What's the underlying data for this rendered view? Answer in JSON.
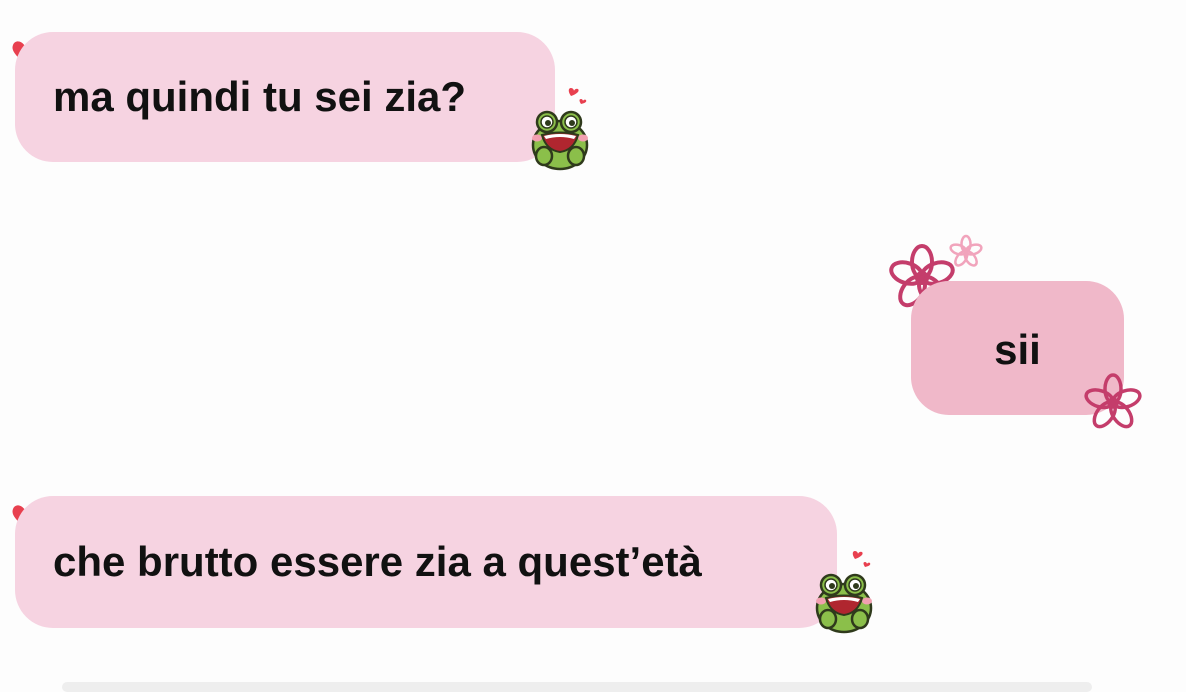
{
  "messages": [
    {
      "text": "ma quindi tu sei zia?",
      "direction": "incoming"
    },
    {
      "text": "sii",
      "direction": "outgoing"
    },
    {
      "text": "che brutto essere zia a quest’età",
      "direction": "incoming"
    }
  ],
  "colors": {
    "background": "#fdfdfd",
    "incoming_bubble": "#f6d3e1",
    "outgoing_bubble": "#f0b8c9",
    "text": "#111111",
    "heart": "#e8404f",
    "flower": "#c43d6b",
    "frog": "#8bbf4a"
  },
  "icons": {
    "message_decor_incoming": [
      "heart-icon",
      "frog-sticker-icon"
    ],
    "message_decor_outgoing": [
      "flower-icon",
      "small-flower-icon"
    ]
  }
}
